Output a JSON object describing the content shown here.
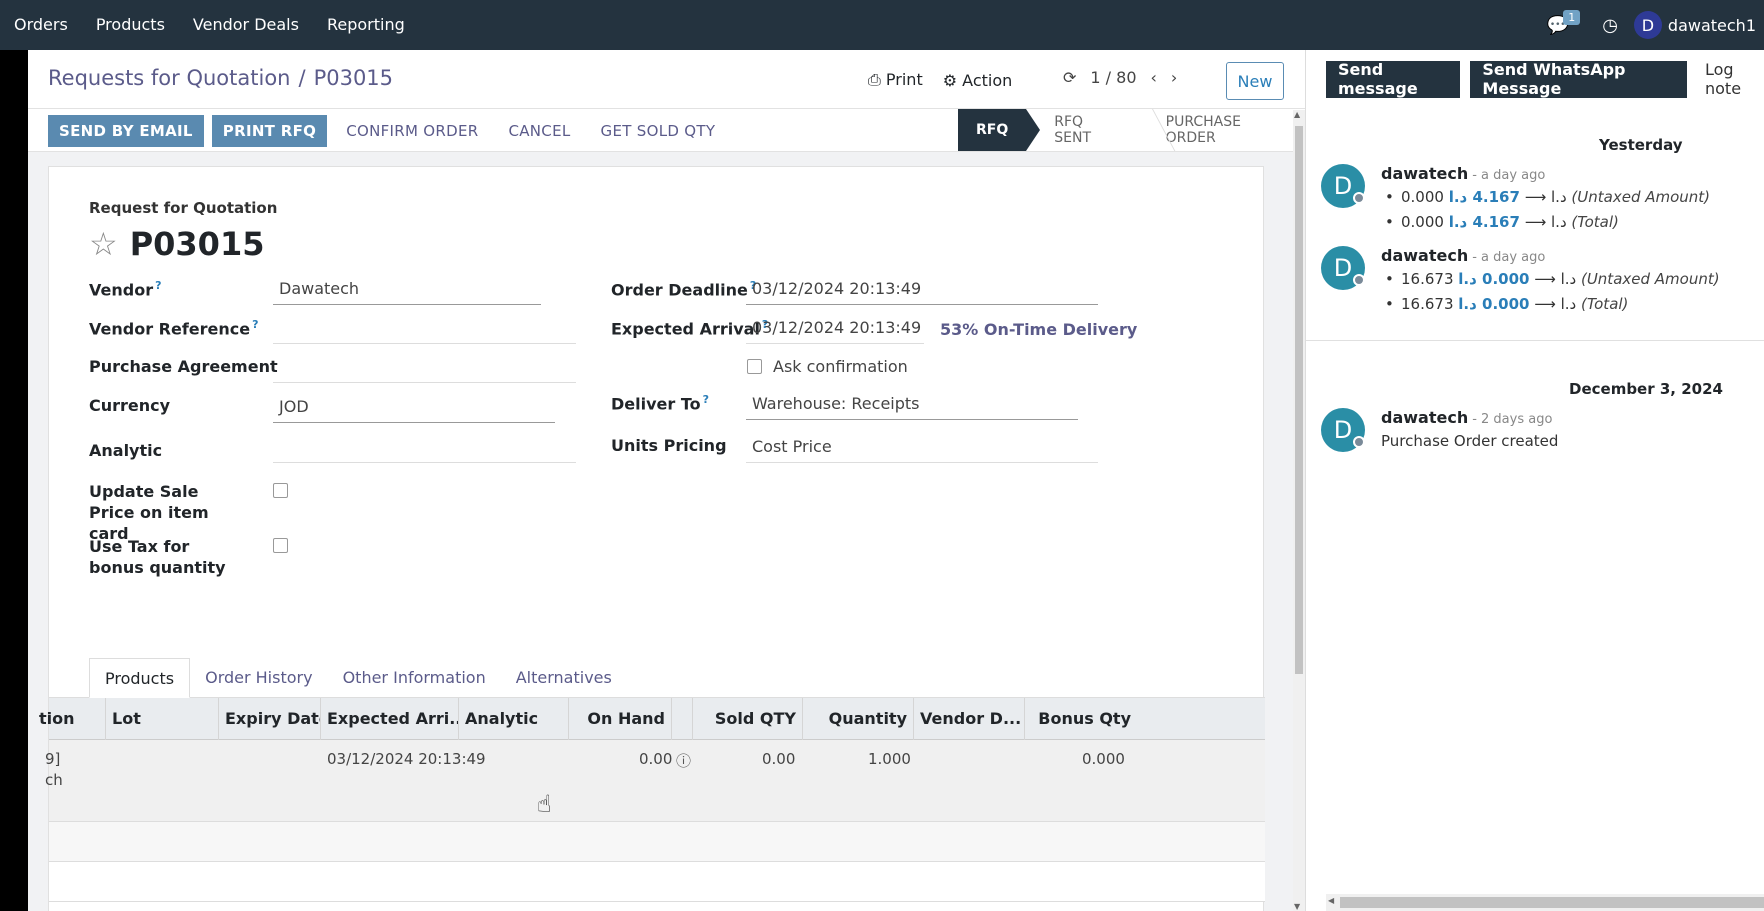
{
  "topbar": {
    "menu": [
      "Orders",
      "Products",
      "Vendor Deals",
      "Reporting"
    ],
    "chat_count": "1",
    "user_initial": "D",
    "user_name": "dawatech1"
  },
  "control_panel": {
    "breadcrumb_parent": "Requests for Quotation",
    "breadcrumb_sep": "/",
    "breadcrumb_current": "P03015",
    "print_label": "Print",
    "action_label": "Action",
    "pager": "1 / 80",
    "new_label": "New"
  },
  "statusbar": {
    "buttons": [
      "SEND BY EMAIL",
      "PRINT RFQ",
      "CONFIRM ORDER",
      "CANCEL",
      "GET SOLD QTY"
    ],
    "stages": [
      "RFQ",
      "RFQ SENT",
      "PURCHASE ORDER"
    ]
  },
  "form": {
    "title_small": "Request for Quotation",
    "name": "P03015",
    "vendor_label": "Vendor",
    "vendor_value": "Dawatech",
    "vendor_ref_label": "Vendor Reference",
    "purchase_agreement_label": "Purchase Agreement",
    "currency_label": "Currency",
    "currency_value": "JOD",
    "analytic_label": "Analytic",
    "update_sale_label": "Update Sale Price on item card",
    "use_tax_label": "Use Tax for bonus quantity",
    "order_deadline_label": "Order Deadline",
    "order_deadline_value": "03/12/2024 20:13:49",
    "expected_arrival_label": "Expected Arrival",
    "expected_arrival_value": "03/12/2024 20:13:49",
    "on_time": "53% On-Time Delivery",
    "ask_confirmation": "Ask confirmation",
    "deliver_to_label": "Deliver To",
    "deliver_to_value": "Warehouse: Receipts",
    "units_pricing_label": "Units Pricing",
    "units_pricing_value": "Cost Price",
    "help_mark": "?"
  },
  "tabs": [
    "Products",
    "Order History",
    "Other Information",
    "Alternatives"
  ],
  "table": {
    "headers": [
      "tion",
      "Lot",
      "Expiry Date",
      "Expected Arri...",
      "Analytic",
      "On Hand",
      "",
      "Sold QTY",
      "Quantity",
      "Vendor D...",
      "Bonus Qty"
    ],
    "row": {
      "product_line1": "9]",
      "product_line2": "ch",
      "expected": "03/12/2024 20:13:49",
      "on_hand": "0.00",
      "sold": "0.00",
      "quantity": "1.000",
      "bonus": "0.000"
    }
  },
  "chatter": {
    "send_message": "Send message",
    "send_whatsapp": "Send WhatsApp Message",
    "log_note": "Log note",
    "day1": "Yesterday",
    "day2": "December 3, 2024",
    "messages": [
      {
        "initial": "D",
        "author": "dawatech",
        "time": "- a day ago",
        "lines": [
          {
            "old": "0.000 د.ا",
            "new": "4.167 د.ا",
            "field": "(Untaxed Amount)"
          },
          {
            "old": "0.000 د.ا",
            "new": "4.167 د.ا",
            "field": "(Total)"
          }
        ]
      },
      {
        "initial": "D",
        "author": "dawatech",
        "time": "- a day ago",
        "lines": [
          {
            "old": "16.673 د.ا",
            "new": "0.000 د.ا",
            "field": "(Untaxed Amount)"
          },
          {
            "old": "16.673 د.ا",
            "new": "0.000 د.ا",
            "field": "(Total)"
          }
        ]
      },
      {
        "initial": "D",
        "author": "dawatech",
        "time": "- 2 days ago",
        "text": "Purchase Order created"
      }
    ]
  }
}
